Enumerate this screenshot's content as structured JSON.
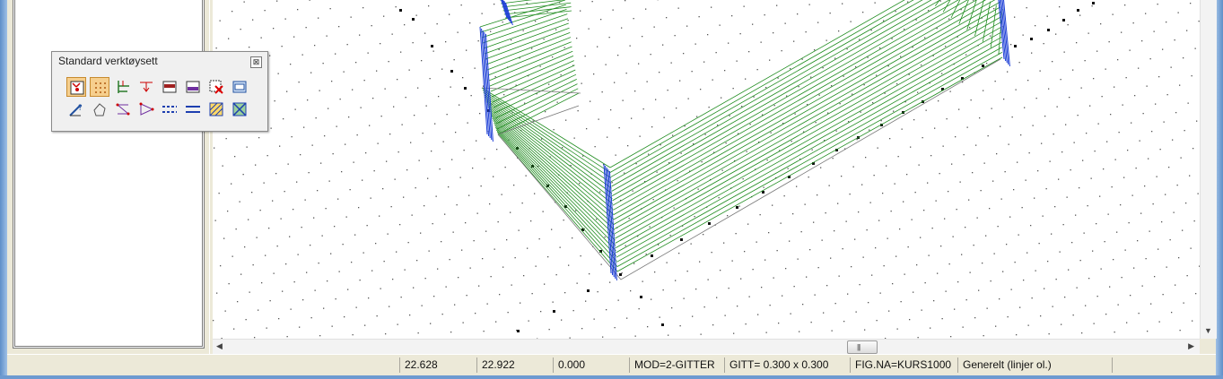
{
  "toolbox": {
    "title": "Standard verktøysett",
    "close_label": "⊠",
    "buttons": [
      {
        "name": "select-point-icon",
        "active": true
      },
      {
        "name": "grid-snap-icon",
        "active": true
      },
      {
        "name": "align-lines-icon",
        "active": false
      },
      {
        "name": "drop-marker-icon",
        "active": false
      },
      {
        "name": "wall-layer-icon",
        "active": false
      },
      {
        "name": "panel-layer-icon",
        "active": false
      },
      {
        "name": "grid-delete-icon",
        "active": false
      },
      {
        "name": "window-frame-icon",
        "active": false
      },
      {
        "name": "measure-help-icon",
        "active": false
      },
      {
        "name": "polygon-icon",
        "active": false
      },
      {
        "name": "node-edit-icon",
        "active": false
      },
      {
        "name": "triangle-node-icon",
        "active": false
      },
      {
        "name": "dashed-line-icon",
        "active": false
      },
      {
        "name": "double-line-icon",
        "active": false
      },
      {
        "name": "hatch-fill-icon",
        "active": false
      },
      {
        "name": "cross-box-icon",
        "active": false
      }
    ]
  },
  "scrollbar": {
    "grip": "|||"
  },
  "statusbar": {
    "x": "22.628",
    "y": "22.922",
    "z": "0.000",
    "mode": "MOD=2-GITTER",
    "grid": "GITT= 0.300 x 0.300",
    "figure": "FIG.NA=KURS1000",
    "layer": "Generelt (linjer ol.)"
  },
  "colors": {
    "green_lines": "#1f8c1f",
    "blue_edges": "#1d3fd6",
    "grid_dots": "#555555"
  }
}
